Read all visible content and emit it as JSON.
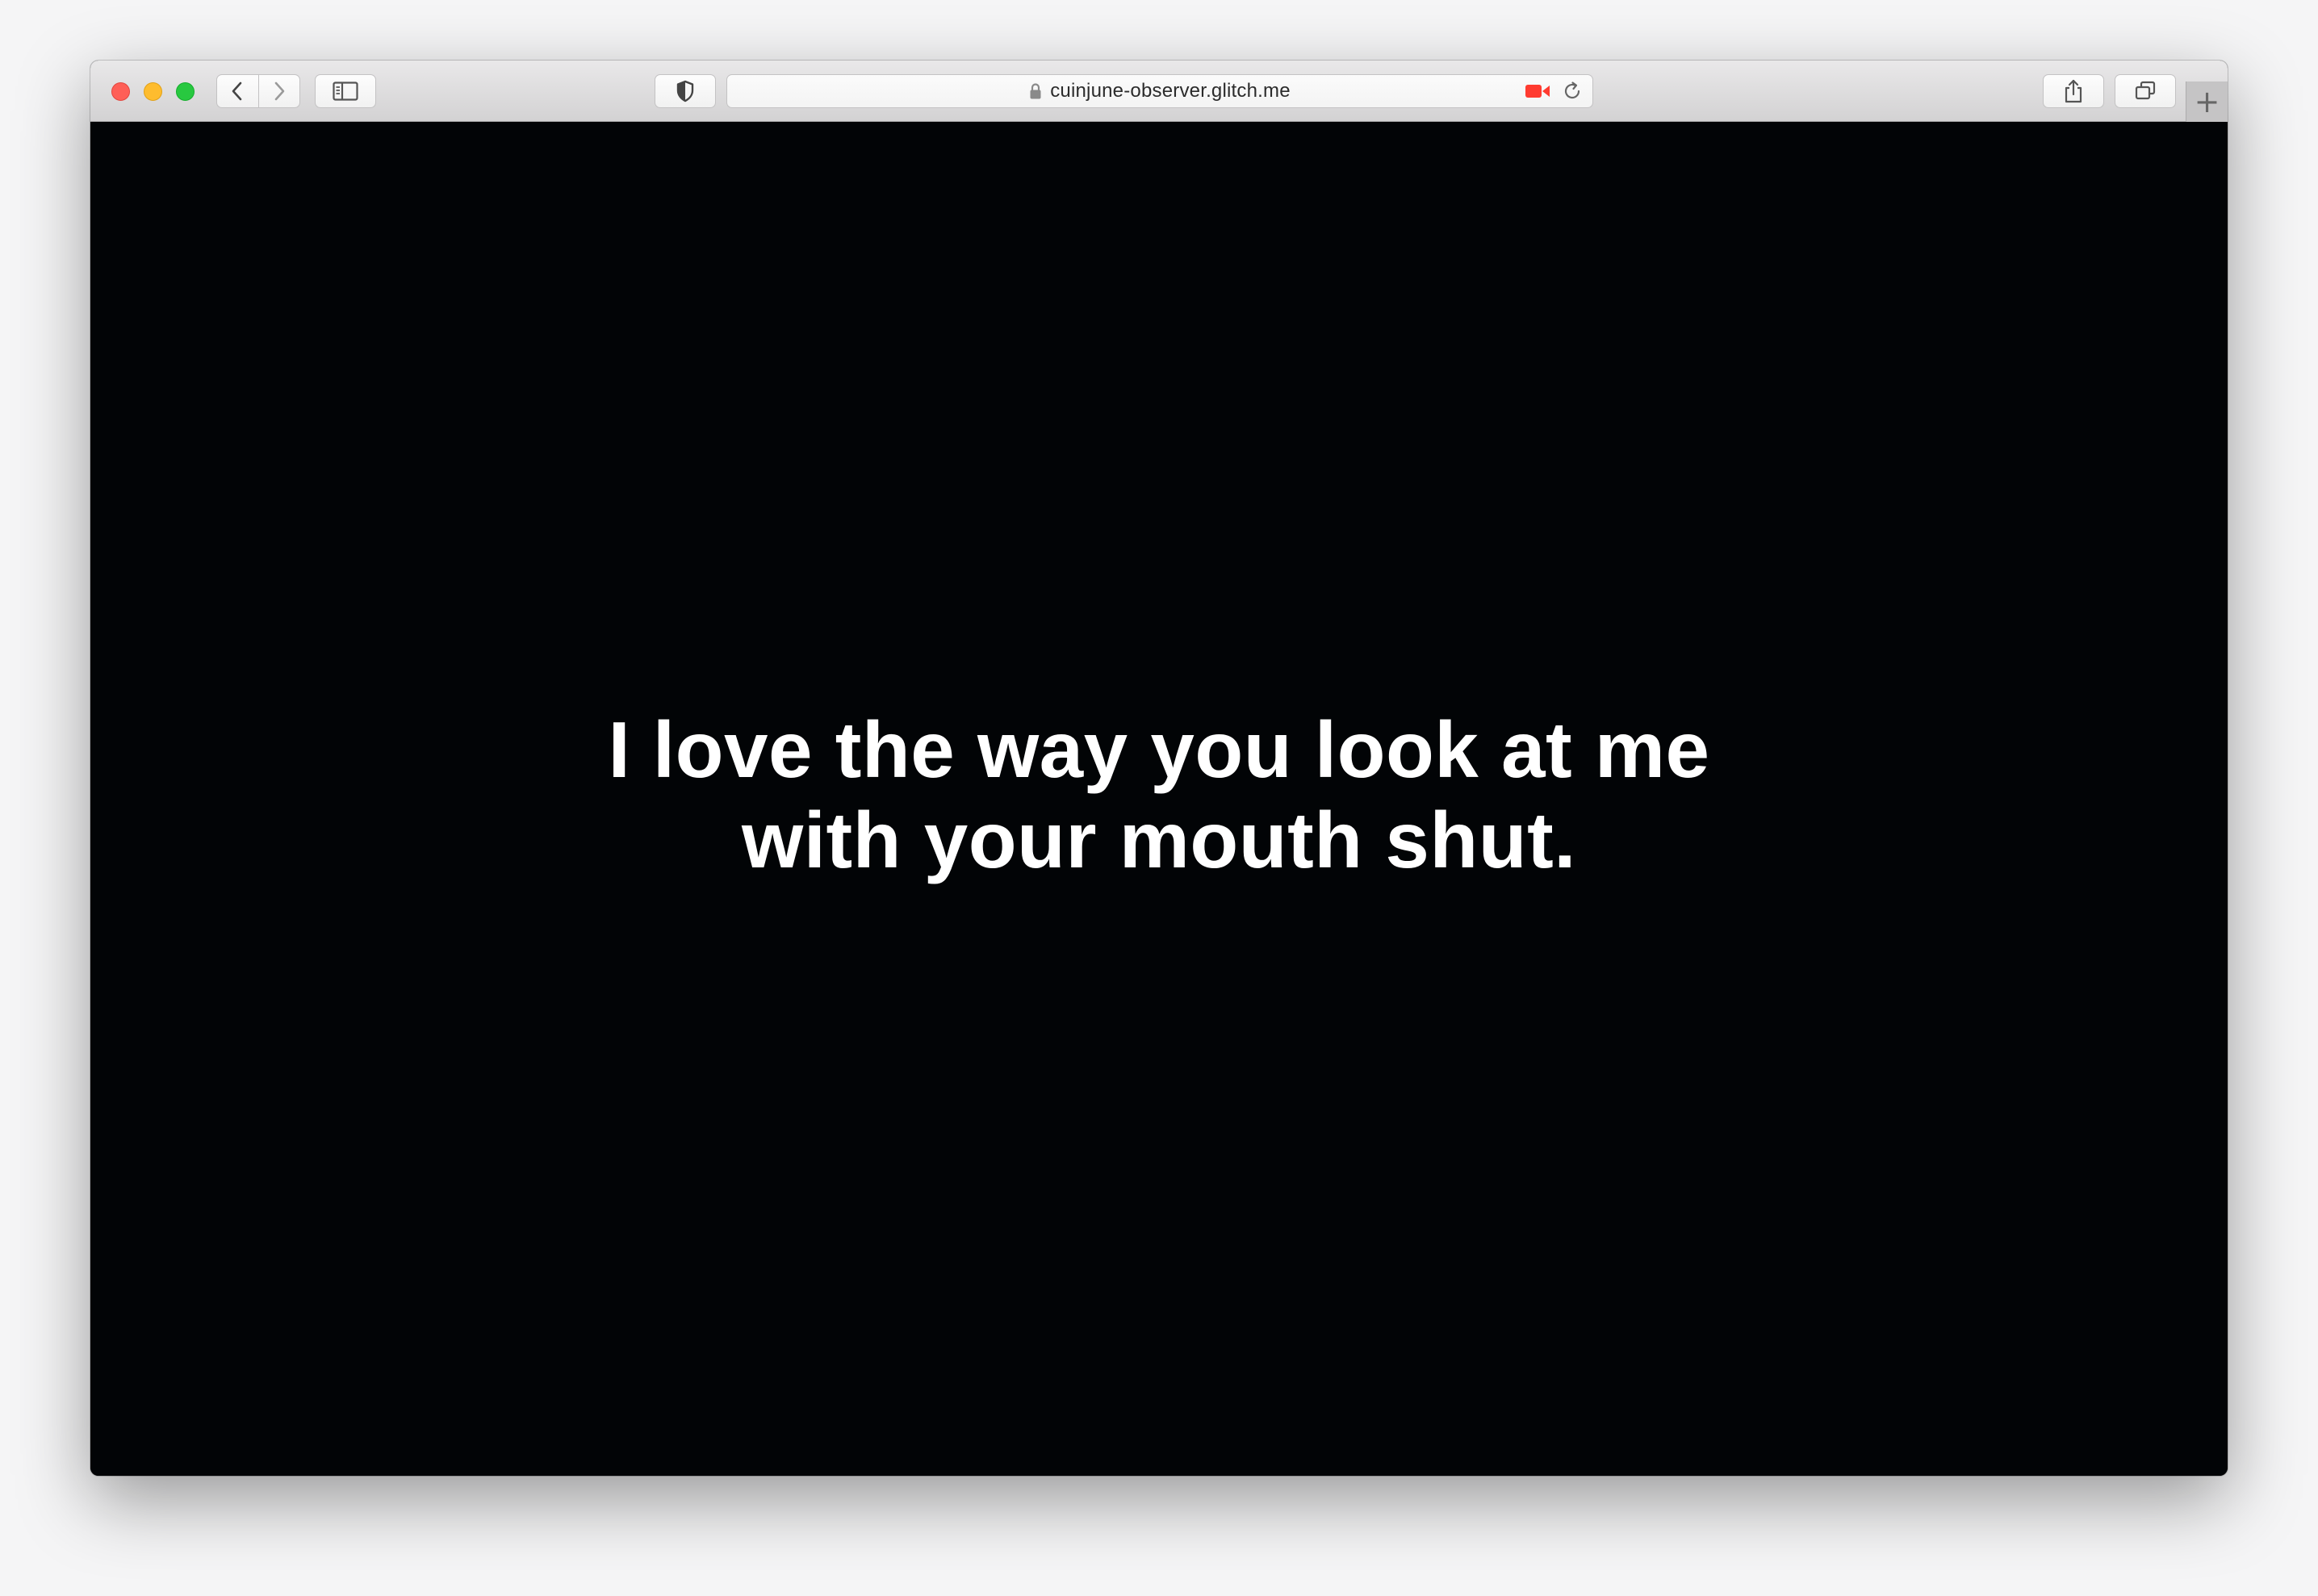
{
  "browser": {
    "url": "cuinjune-observer.glitch.me",
    "new_tab_label": "+",
    "icons": {
      "back": "chevron-left-icon",
      "forward": "chevron-right-icon",
      "sidebar": "sidebar-icon",
      "privacy": "shield-icon",
      "lock": "lock-icon",
      "camera": "camera-recording-icon",
      "reload": "reload-icon",
      "share": "share-icon",
      "tabs": "tab-overview-icon"
    },
    "colors": {
      "close": "#fe5f57",
      "minimize": "#febc2e",
      "maximize": "#28c840",
      "camera_active": "#ff3b30"
    }
  },
  "page": {
    "background": "#020406",
    "quote_lines": [
      "I love the way you look at me",
      "with your mouth shut."
    ]
  }
}
